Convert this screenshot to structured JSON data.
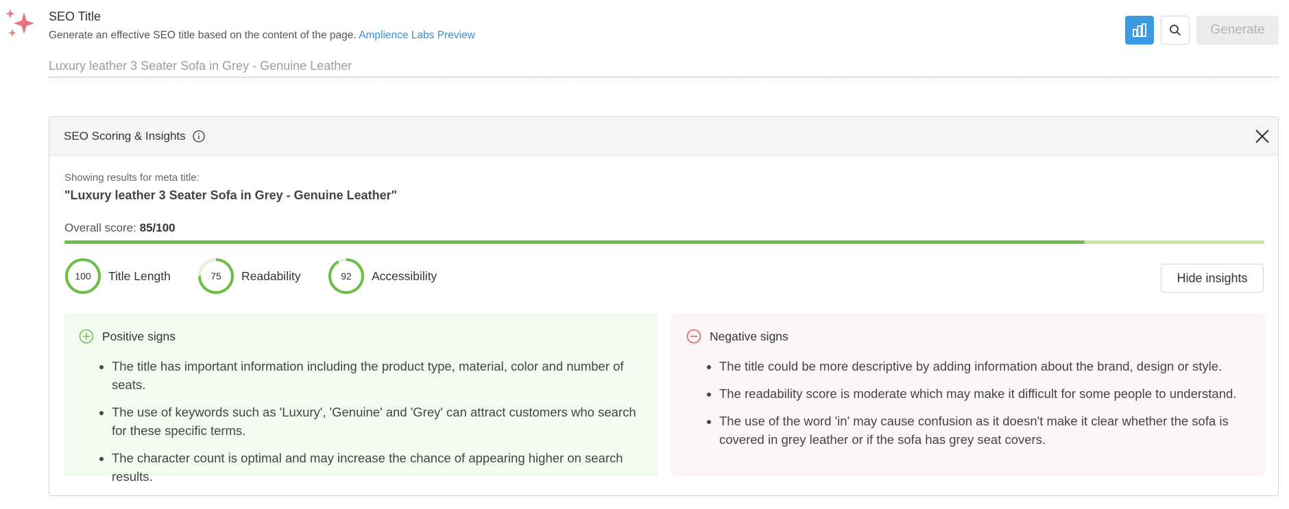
{
  "header": {
    "title": "SEO Title",
    "subtitle": "Generate an effective SEO title based on the content of the page.",
    "preview_link": "Amplience Labs Preview",
    "generate_label": "Generate",
    "icons": {
      "logo": "sparkle-icon",
      "chart": "bar-chart-icon",
      "search": "search-icon"
    }
  },
  "input": {
    "value": "Luxury leather 3 Seater Sofa in Grey - Genuine Leather"
  },
  "insights": {
    "title": "SEO Scoring & Insights",
    "showing_label": "Showing results for meta title:",
    "quoted_title": "\"Luxury leather 3 Seater Sofa in Grey - Genuine Leather\"",
    "overall_label": "Overall score:",
    "overall_value": "85/100",
    "overall_fraction": 0.85,
    "metrics": [
      {
        "score": "100",
        "label": "Title Length",
        "fraction": 1.0
      },
      {
        "score": "75",
        "label": "Readability",
        "fraction": 0.75
      },
      {
        "score": "92",
        "label": "Accessibility",
        "fraction": 0.92
      }
    ],
    "hide_label": "Hide insights",
    "positive": {
      "heading": "Positive signs",
      "items": [
        "The title has important information including the product type, material, color and number of seats.",
        "The use of keywords such as 'Luxury', 'Genuine' and 'Grey' can attract customers who search for these specific terms.",
        "The character count is optimal and may increase the chance of appearing higher on search results."
      ]
    },
    "negative": {
      "heading": "Negative signs",
      "items": [
        "The title could be more descriptive by adding information about the brand, design or style.",
        "The readability score is moderate which may make it difficult for some people to understand.",
        "The use of the word 'in' may cause confusion as it doesn't make it clear whether the sofa is covered in grey leather or if the sofa has grey seat covers."
      ]
    }
  },
  "colors": {
    "accent": "#3b9ae1",
    "link": "#3a8fd1",
    "score_green": "#6bbf45",
    "positive_bg": "#f3fbf1",
    "negative_bg": "#fcf6f6",
    "negative_red": "#e05a6e",
    "sparkle": "#e8737f"
  }
}
